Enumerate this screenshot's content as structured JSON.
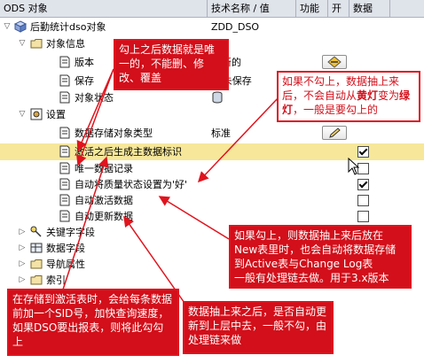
{
  "header": {
    "col_object": "ODS 对象",
    "col_tech": "技术名称 / 值",
    "col_func": "功能",
    "col_open": "开",
    "col_data": "数据"
  },
  "tree": {
    "root_label": "后勤统计dso对象",
    "root_value": "ZDD_DSO",
    "info_label": "对象信息",
    "version_label": "版本",
    "version_value": "新的",
    "save_label": "保存",
    "save_value": "未保存",
    "state_label": "对象状态",
    "settings_label": "设置",
    "storage_type_label": "数据存储对象类型",
    "storage_type_value": "标准",
    "sid_label": "激活之后生成主数据标识",
    "unique_label": "唯一数据记录",
    "quality_label": "自动将质量状态设置为'好'",
    "auto_activate_label": "自动激活数据",
    "auto_update_label": "自动更新数据",
    "key_fields_label": "关键字字段",
    "data_fields_label": "数据字段",
    "nav_attr_label": "导航属性",
    "index_label": "索引"
  },
  "checkboxes": {
    "sid": true,
    "unique": false,
    "quality": true,
    "auto_activate": false,
    "auto_update": false
  },
  "notes": {
    "n1": "勾上之后数据就是唯一的，不能删、修改、覆盖",
    "n2_a": "如果不勾上，数据抽上来后，不会自动从",
    "n2_yellow": "黄灯",
    "n2_b": "变为",
    "n2_green": "绿灯",
    "n2_c": "，一般是要勾上的",
    "n3": "如果勾上，则数据抽上来后放在New表里时，也会自动将数据存储到Active表与Change Log表",
    "n3_sub": "一般有处理链去做。用于3.x版本",
    "n4": "在存储到激活表时，会给每条数据前加一个SID号，加快查询速度，如果DSO要出报表，则将此勾勾上",
    "n5": "数据抽上来之后，是否自动更新到上层中去，一般不勾，由处理链来做"
  },
  "colors": {
    "note_red": "#d20f1a",
    "highlight_yellow": "#ffe000",
    "selection": "#f6e79a"
  }
}
